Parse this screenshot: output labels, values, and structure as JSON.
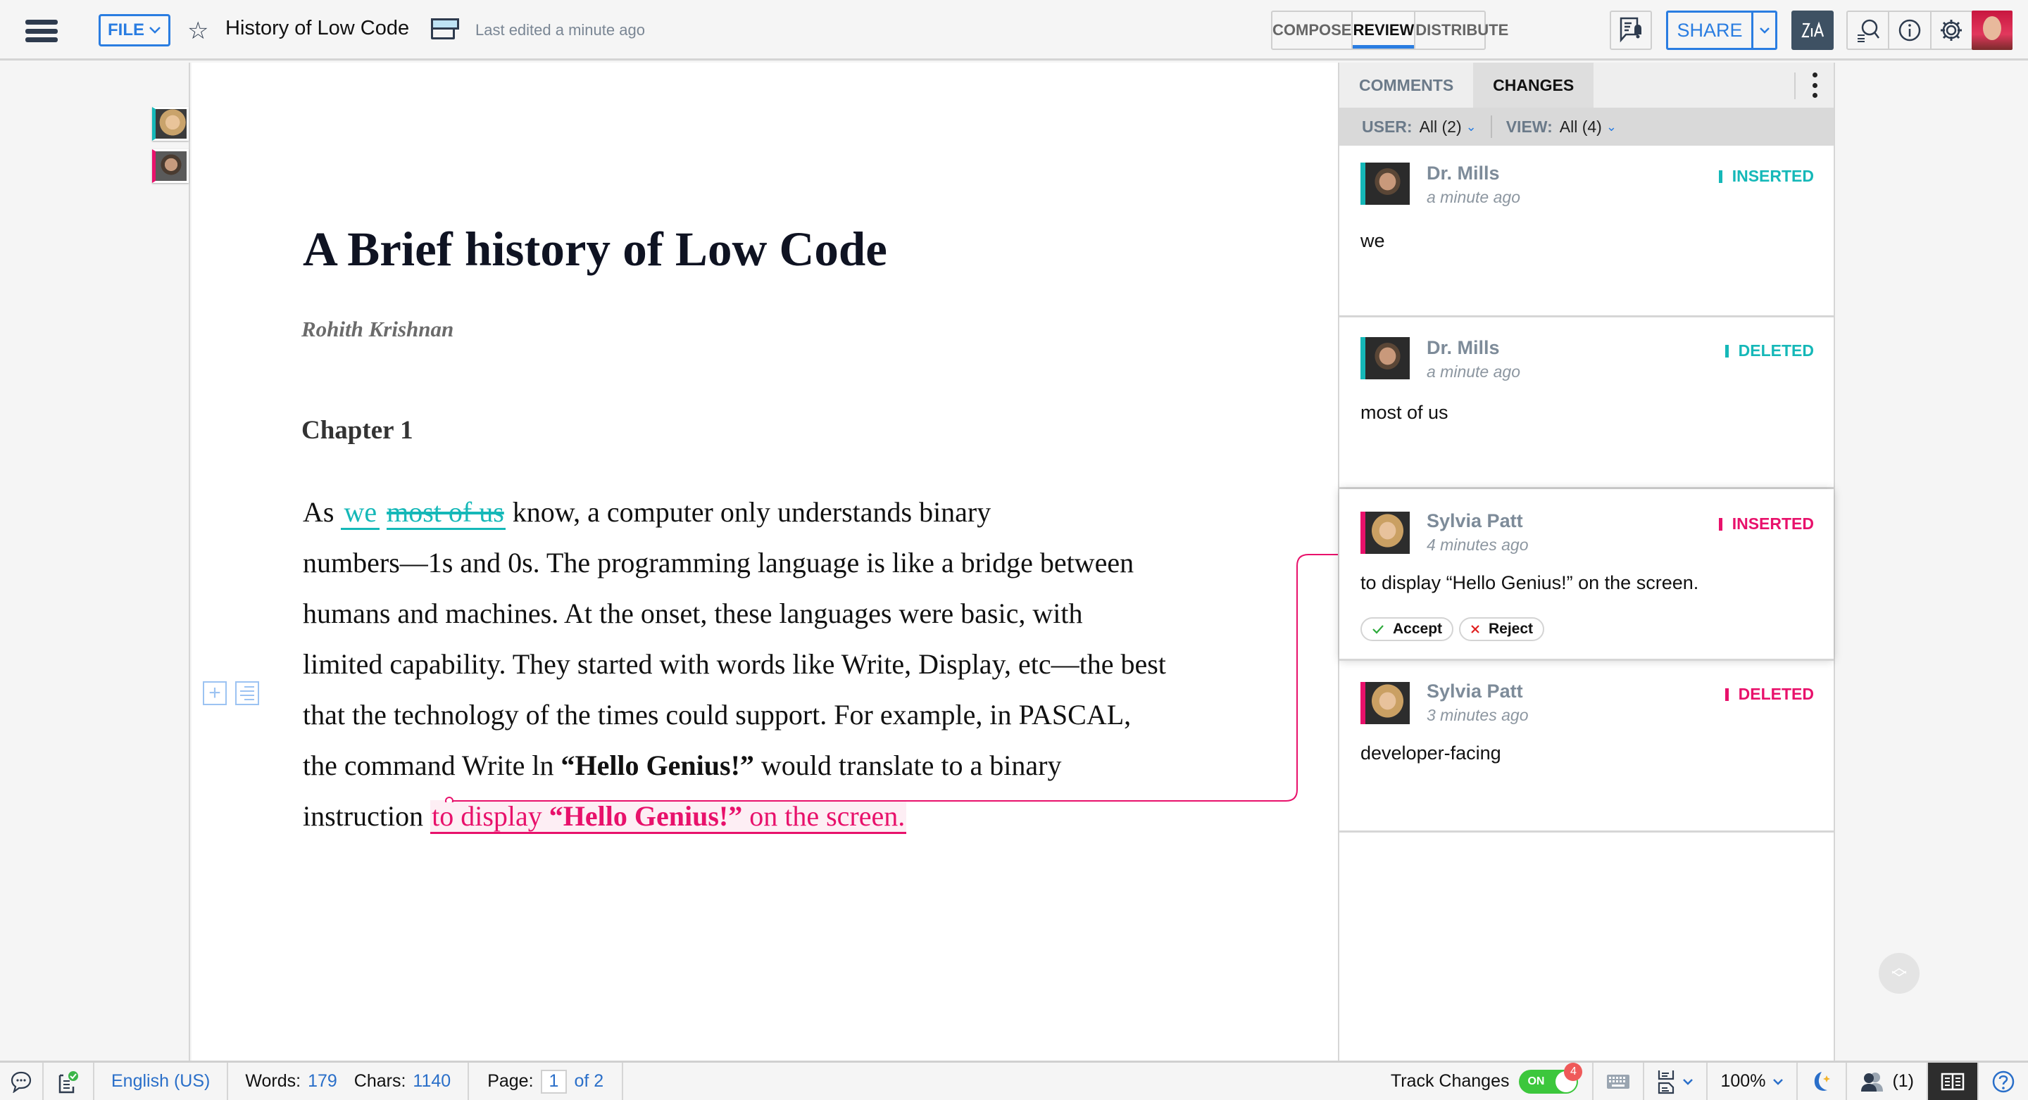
{
  "topbar": {
    "file_label": "FILE",
    "doc_title": "History of Low Code",
    "last_edited": "Last edited a minute ago",
    "modes": [
      {
        "label": "COMPOSE",
        "active": false
      },
      {
        "label": "REVIEW",
        "active": true
      },
      {
        "label": "DISTRIBUTE",
        "active": false
      }
    ],
    "share_label": "SHARE",
    "zia_label": "Zia"
  },
  "document": {
    "title": "A Brief history of Low Code",
    "author": "Rohith Krishnan",
    "chapter": "Chapter 1",
    "paragraph": {
      "l1_a": "As ",
      "l1_ins": "we",
      "l1_del": "most of us",
      "l1_b": " know, a computer only understands binary",
      "l2": "numbers—1s and 0s. The programming language is like a bridge between",
      "l3": "humans and machines. At the onset, these languages were basic, with",
      "l4": "limited capability. They started with words like  Write,  Display, etc—the best",
      "l5": "that the technology of the times could support. For example, in  PASCAL,",
      "l6_a": "the command Write ln  ",
      "l6_bold": "“Hello Genius!”",
      "l6_b": " would translate to a binary",
      "l7_a": "instruction ",
      "l7_ins_a": "to display  ",
      "l7_ins_bold": "“Hello Genius!”",
      "l7_ins_b": " on the screen."
    }
  },
  "panel": {
    "tabs": [
      {
        "label": "COMMENTS",
        "active": false
      },
      {
        "label": "CHANGES",
        "active": true
      }
    ],
    "filter": {
      "user_label": "USER:",
      "user_value": "All (2)",
      "view_label": "VIEW:",
      "view_value": "All (4)"
    },
    "changes": [
      {
        "user": "Dr. Mills",
        "time": "a minute ago",
        "type": "INSERTED",
        "text": "we",
        "color": "#15b8b8"
      },
      {
        "user": "Dr. Mills",
        "time": "a minute ago",
        "type": "DELETED",
        "text": "most of us",
        "color": "#15b8b8"
      },
      {
        "user": "Sylvia Patt",
        "time": "4 minutes ago",
        "type": "INSERTED",
        "text": "to display “Hello Genius!” on the screen.",
        "color": "#e8116b",
        "selected": true
      },
      {
        "user": "Sylvia Patt",
        "time": "3 minutes ago",
        "type": "DELETED",
        "text": "developer-facing",
        "color": "#e8116b"
      }
    ],
    "accept_label": "Accept",
    "reject_label": "Reject"
  },
  "statusbar": {
    "language": "English (US)",
    "words_label": "Words:",
    "words": "179",
    "chars_label": "Chars:",
    "chars": "1140",
    "page_label": "Page:",
    "page_current": "1",
    "page_total": "of 2",
    "track_changes_label": "Track Changes",
    "track_changes_state": "ON",
    "track_changes_count": "4",
    "zoom": "100%",
    "collaborators": "(1)"
  },
  "colors": {
    "accent": "#2a7de1",
    "user1_color": "#15b8b8",
    "user2_color": "#e8116b"
  }
}
